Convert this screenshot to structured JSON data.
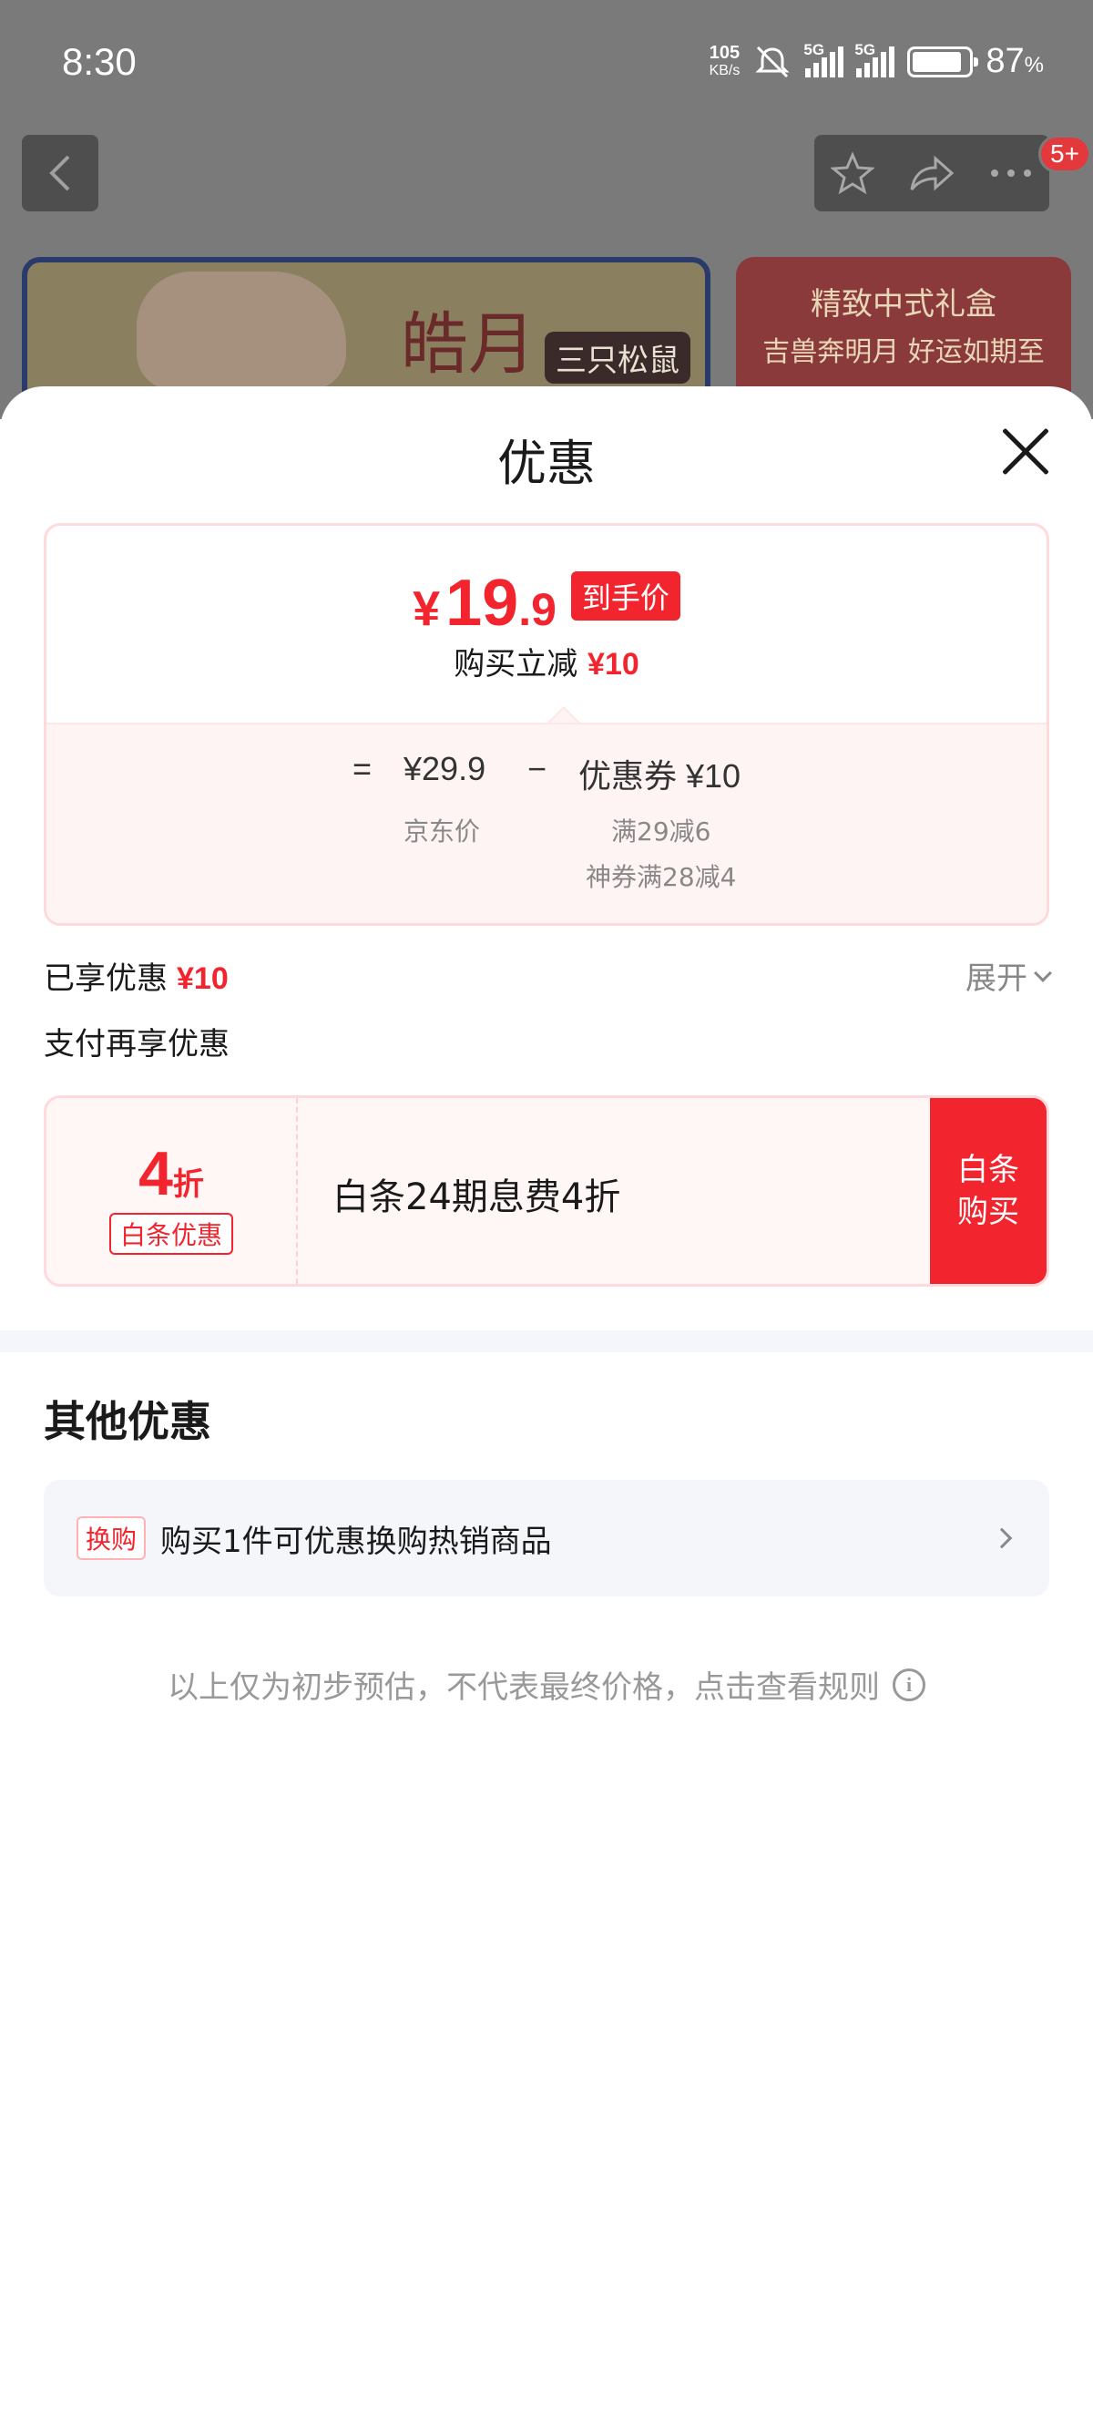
{
  "status_bar": {
    "time": "8:30",
    "net_speed_value": "105",
    "net_speed_unit": "KB/s",
    "signal1_label": "5G",
    "signal2_label": "5G",
    "battery_pct": "87",
    "battery_unit": "%",
    "battery_level": 0.87
  },
  "background": {
    "badge_count": "5+",
    "banner_left_text": "皓月",
    "banner_left_logo": "三只松鼠",
    "banner_right_line1": "精致中式礼盒",
    "banner_right_line2": "吉兽奔明月 好运如期至"
  },
  "sheet": {
    "title": "优惠",
    "price": {
      "currency": "¥",
      "integer": "19",
      "decimal": ".9",
      "final_tag": "到手价",
      "saving_label": "购买立减",
      "saving_amount": "¥10",
      "equals": "=",
      "jd_price": "¥29.9",
      "jd_price_label": "京东价",
      "minus": "−",
      "coupon": "优惠券 ¥10",
      "coupon_detail1": "满29减6",
      "coupon_detail2": "神券满28减4"
    },
    "enjoyed_label": "已享优惠",
    "enjoyed_amount": "¥10",
    "expand_label": "展开",
    "pay_more_label": "支付再享优惠",
    "pay_offer": {
      "discount_num": "4",
      "discount_unit": "折",
      "tag": "白条优惠",
      "description": "白条24期息费4折",
      "button_line1": "白条",
      "button_line2": "购买"
    },
    "other_title": "其他优惠",
    "promo": {
      "tag": "换购",
      "text": "购买1件可优惠换购热销商品"
    },
    "footer_note": "以上仅为初步预估，不代表最终价格，点击查看规则"
  },
  "colors": {
    "accent_red": "#f2242e",
    "overlay_gray": "#7a7a7a"
  }
}
